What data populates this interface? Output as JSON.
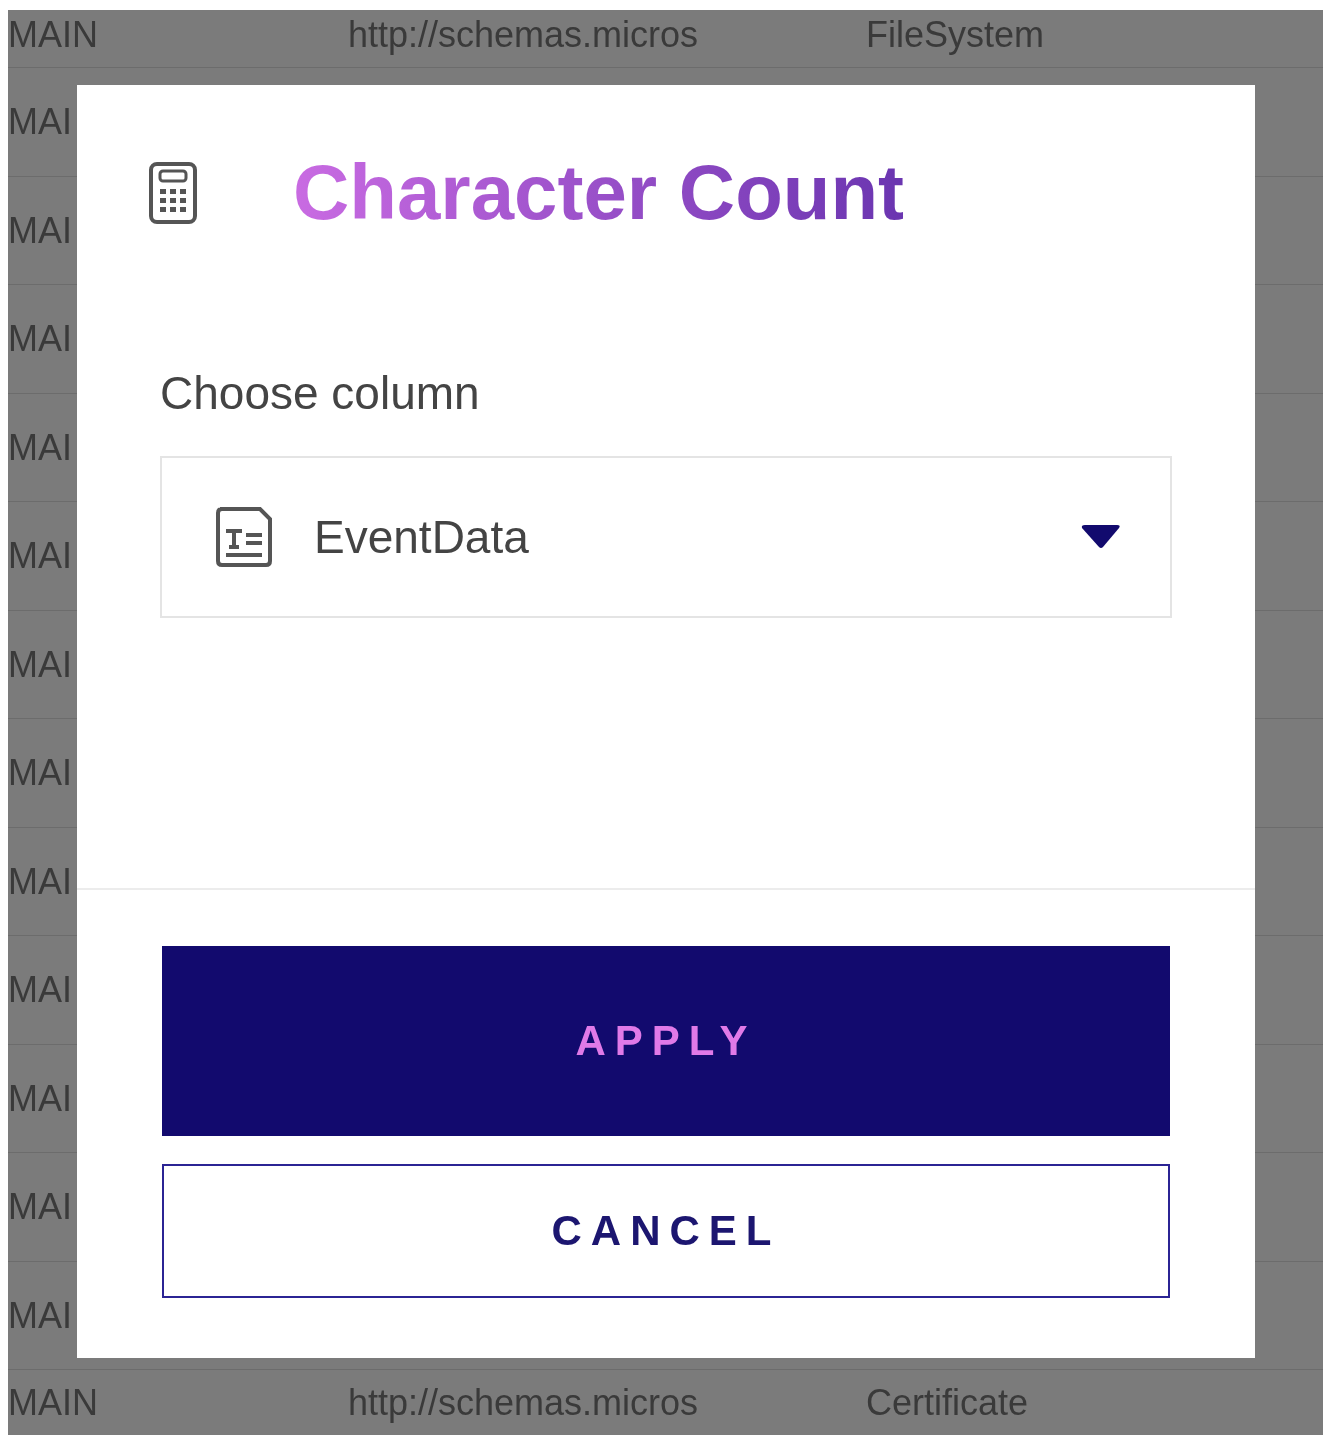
{
  "background_table": {
    "rows": [
      {
        "cells": [
          "MAIN",
          "http://schemas.micros",
          "FileSystem"
        ]
      },
      {
        "cells": [
          "MAI"
        ]
      },
      {
        "cells": [
          "MAI"
        ]
      },
      {
        "cells": [
          "MAI"
        ]
      },
      {
        "cells": [
          "MAI"
        ]
      },
      {
        "cells": [
          "MAI"
        ]
      },
      {
        "cells": [
          "MAI"
        ]
      },
      {
        "cells": [
          "MAI"
        ]
      },
      {
        "cells": [
          "MAI"
        ]
      },
      {
        "cells": [
          "MAI"
        ]
      },
      {
        "cells": [
          "MAI"
        ]
      },
      {
        "cells": [
          "MAI"
        ]
      },
      {
        "cells": [
          "MAI"
        ]
      },
      {
        "cells": [
          "MAIN",
          "http://schemas.micros",
          "Certificate"
        ]
      }
    ]
  },
  "dialog": {
    "title": "Character Count",
    "label": "Choose column",
    "select": {
      "value": "EventData"
    },
    "buttons": [
      {
        "label": "APPLY",
        "kind": "primary"
      },
      {
        "label": "CANCEL",
        "kind": "secondary"
      }
    ]
  }
}
